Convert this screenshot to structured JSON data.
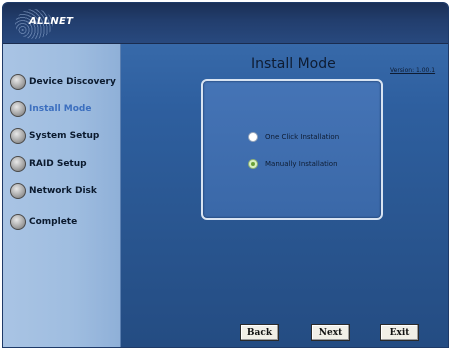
{
  "app": {
    "logo_text": "ALLNET"
  },
  "sidebar": {
    "items": [
      {
        "label": "Device Discovery",
        "active": false
      },
      {
        "label": "Install Mode",
        "active": true
      },
      {
        "label": "System Setup",
        "active": false
      },
      {
        "label": "RAID Setup",
        "active": false
      },
      {
        "label": "Network Disk",
        "active": false
      },
      {
        "label": "Complete",
        "active": false
      }
    ]
  },
  "main": {
    "title": "Install Mode",
    "version": "Version: 1.00.1",
    "options": [
      {
        "label": "One Click Installation",
        "selected": false
      },
      {
        "label": "Manually Installation",
        "selected": true
      }
    ]
  },
  "buttons": {
    "back": "Back",
    "next": "Next",
    "exit": "Exit"
  },
  "colors": {
    "accent_active": "#3c6fbf",
    "background": "#2e5f9f",
    "sidebar": "#a9c4e4"
  }
}
